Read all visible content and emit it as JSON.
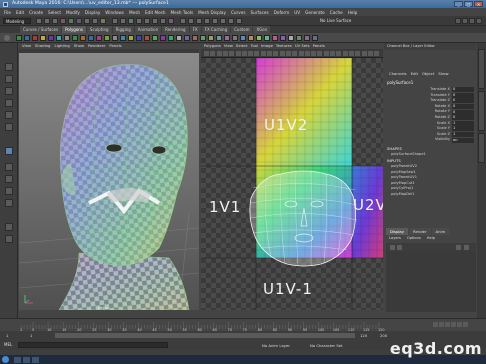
{
  "window": {
    "title": "Autodesk Maya 2016: C:\\Users\\...\\uv_editor_13.mb* --- polySurface1",
    "controls": [
      "_",
      "□",
      "✕"
    ]
  },
  "menubar": [
    "File",
    "Edit",
    "Create",
    "Select",
    "Modify",
    "Display",
    "Windows",
    "Mesh",
    "Edit Mesh",
    "Mesh Tools",
    "Mesh Display",
    "Curves",
    "Surfaces",
    "Deform",
    "UV",
    "Generate",
    "Cache",
    "Help"
  ],
  "statusline": {
    "mode": "Modeling",
    "live_surface": "No Live Surface"
  },
  "shelf_tabs": [
    "Curves / Surfaces",
    "Polygons",
    "Sculpting",
    "Rigging",
    "Animation",
    "Rendering",
    "FX",
    "FX Caching",
    "Custom",
    "XGen"
  ],
  "shelf_active": "Polygons",
  "viewport": {
    "menu": [
      "View",
      "Shading",
      "Lighting",
      "Show",
      "Renderer",
      "Panels"
    ],
    "camera_label": "persp"
  },
  "uv_editor": {
    "menu": [
      "Polygons",
      "View",
      "Select",
      "Tool",
      "Image",
      "Textures",
      "UV Sets",
      "Panels"
    ],
    "labels": {
      "top": "U1V2",
      "left": "1V1",
      "right": "U2V",
      "bottom": "U1V-1"
    }
  },
  "channel_box": {
    "header": "Channel Box / Layer Editor",
    "tabs": [
      "Channels",
      "Edit",
      "Object",
      "Show"
    ],
    "object": "polySurface1",
    "attributes": [
      {
        "name": "Translate X",
        "value": "0"
      },
      {
        "name": "Translate Y",
        "value": "0"
      },
      {
        "name": "Translate Z",
        "value": "0"
      },
      {
        "name": "Rotate X",
        "value": "0"
      },
      {
        "name": "Rotate Y",
        "value": "0"
      },
      {
        "name": "Rotate Z",
        "value": "0"
      },
      {
        "name": "Scale X",
        "value": "1"
      },
      {
        "name": "Scale Y",
        "value": "1"
      },
      {
        "name": "Scale Z",
        "value": "1"
      },
      {
        "name": "Visibility",
        "value": "on"
      }
    ],
    "shapes_header": "SHAPES",
    "shape": "polySurfaceShape1",
    "inputs_header": "INPUTS",
    "inputs": [
      "polyTweakUV2",
      "polyMapSew1",
      "polyTweakUV1",
      "polyMapCut1",
      "polyCylProj1",
      "polyMapDel1"
    ]
  },
  "layer_editor": {
    "tabs": [
      "Display",
      "Render",
      "Anim"
    ],
    "active_tab": "Display",
    "menu": [
      "Layers",
      "Options",
      "Help"
    ]
  },
  "timeline": {
    "ticks": [
      "1",
      "5",
      "10",
      "15",
      "20",
      "25",
      "30",
      "35",
      "40",
      "45",
      "50",
      "55",
      "60",
      "65",
      "70",
      "75",
      "80",
      "85",
      "90",
      "95",
      "100",
      "105",
      "110",
      "115",
      "120"
    ],
    "start": "1",
    "range_start": "1",
    "range_end": "120",
    "end": "200",
    "anim_layer": "No Anim Layer",
    "character_set": "No Character Set"
  },
  "command_line": {
    "label": "MEL"
  },
  "watermark": "eq3d.com",
  "colors": {
    "accent": "#5e84b0",
    "active_tab": "#5a5a5a",
    "selection": "#9fe08c"
  }
}
